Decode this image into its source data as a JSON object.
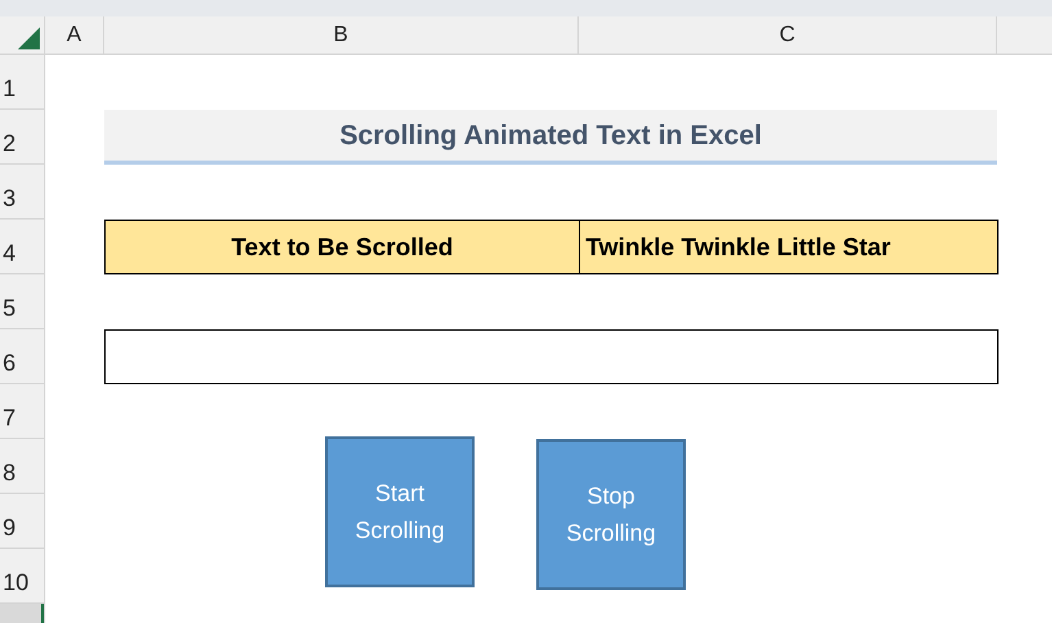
{
  "column_headers": [
    "A",
    "B",
    "C"
  ],
  "row_headers": [
    "1",
    "2",
    "3",
    "4",
    "5",
    "6",
    "7",
    "8",
    "9",
    "10"
  ],
  "title": "Scrolling Animated Text in Excel",
  "input_row": {
    "label": "Text to Be Scrolled",
    "value": "Twinkle Twinkle Little Star"
  },
  "buttons": [
    {
      "label": "Start Scrolling"
    },
    {
      "label": "Stop Scrolling"
    }
  ]
}
